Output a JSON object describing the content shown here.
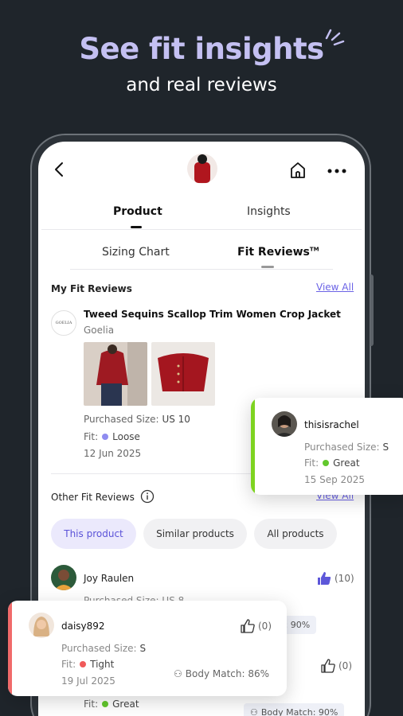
{
  "hero": {
    "title": "See fit insights",
    "subtitle": "and real reviews"
  },
  "tabs": {
    "product": "Product",
    "insights": "Insights"
  },
  "subtabs": {
    "sizing": "Sizing Chart",
    "fit": "Fit Reviews",
    "fit_tm": "TM"
  },
  "my_reviews": {
    "label": "My Fit Reviews",
    "view_all": "View All",
    "brand_logo": "GOELIA",
    "product_title": "Tweed Sequins Scallop Trim Women Crop Jacket",
    "brand": "Goelia",
    "purchased_label": "Purchased Size:",
    "purchased_value": "US 10",
    "fit_label": "Fit:",
    "fit_value": "Loose",
    "fit_color": "#8f8cf0",
    "date": "12 Jun 2025"
  },
  "other_reviews": {
    "label": "Other Fit Reviews",
    "view_all": "View All",
    "filters": [
      "This product",
      "Similar products",
      "All products"
    ]
  },
  "review_joy": {
    "name": "Joy Raulen",
    "likes": "(10)",
    "purchased_partial": "Purchased Size: US 8",
    "body_match_partial": "y Match: 90%",
    "likes_second": "(0)",
    "fit_label": "Fit:",
    "fit_value": "Great",
    "fit_color": "#62c82d",
    "body_match": "Body Match: 90%"
  },
  "card_rachel": {
    "name": "thisisrachel",
    "purchased_label": "Purchased Size:",
    "purchased_value": "S",
    "fit_label": "Fit:",
    "fit_value": "Great",
    "fit_color": "#62c82d",
    "date": "15 Sep 2025",
    "bar_color": "#7ed321"
  },
  "card_daisy": {
    "name": "daisy892",
    "likes": "(0)",
    "purchased_label": "Purchased Size:",
    "purchased_value": "S",
    "fit_label": "Fit:",
    "fit_value": "Tight",
    "fit_color": "#f05a5a",
    "date": "19 Jul 2025",
    "body_match": "Body Match: 86%",
    "bar_color": "#f06a6a"
  }
}
